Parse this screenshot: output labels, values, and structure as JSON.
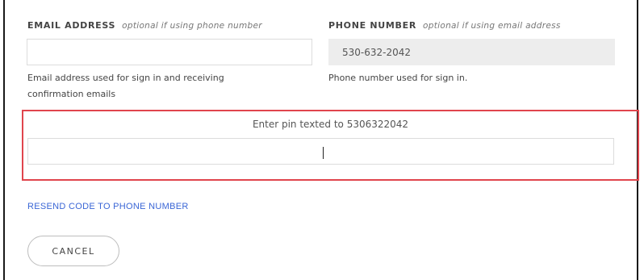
{
  "email": {
    "label": "EMAIL ADDRESS",
    "optional_note": "optional if using phone number",
    "value": "",
    "help_line1": "Email address used for sign in and receiving",
    "help_line2": "confirmation emails"
  },
  "phone": {
    "label": "PHONE NUMBER",
    "optional_note": "optional if using email address",
    "value": "530-632-2042",
    "help": "Phone number used for sign in."
  },
  "pin": {
    "label": "Enter pin texted to 5306322042",
    "value": ""
  },
  "actions": {
    "resend_label": "RESEND CODE TO PHONE NUMBER",
    "cancel_label": "CANCEL"
  },
  "colors": {
    "highlight_border": "#e0454d",
    "link": "#3a66d6"
  }
}
